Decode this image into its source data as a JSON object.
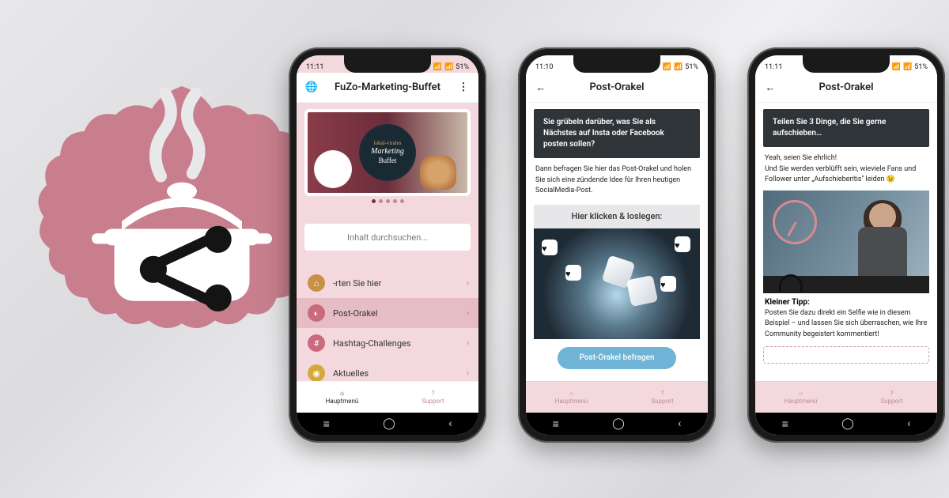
{
  "status": {
    "time1": "11:11",
    "time2": "11:10",
    "time3": "11:11",
    "battery": "51%"
  },
  "badge": {
    "color": "#c87e8d"
  },
  "phone1": {
    "title": "FuZo-Marketing-Buffet",
    "hero": {
      "line1": "lokal-virales",
      "line2": "Marketing",
      "line3": "Buffet"
    },
    "search_placeholder": "Inhalt durchsuchen...",
    "menu": [
      {
        "label": "-rten Sie hier"
      },
      {
        "label": "Post-Orakel"
      },
      {
        "label": "Hashtag-Challenges"
      },
      {
        "label": "Aktuelles"
      }
    ],
    "nav": {
      "home": "Hauptmenü",
      "support": "Support"
    }
  },
  "phone2": {
    "title": "Post-Orakel",
    "headline": "Sie grübeln darüber, was Sie als Nächstes auf Insta oder Facebook posten sollen?",
    "body": "Dann befragen Sie hier das Post-Orakel und holen Sie sich eine zündende Idee für Ihren heutigen SocialMedia-Post.",
    "cta_head": "Hier klicken & loslegen:",
    "button": "Post-Orakel befragen",
    "nav": {
      "home": "Hauptmenü",
      "support": "Support"
    }
  },
  "phone3": {
    "title": "Post-Orakel",
    "headline": "Teilen Sie 3 Dinge, die Sie gerne aufschieben…",
    "body": "Yeah, seien Sie ehrlich!\nUnd Sie werden verblüfft sein, wieviele Fans und Follower unter „Aufschieberitis\" leiden 😉",
    "tip_head": "Kleiner Tipp:",
    "tip_body": "Posten Sie dazu direkt ein Selfie wie in diesem Beispiel – und lassen Sie sich überraschen, wie Ihre Community begeistert kommentiert!",
    "nav": {
      "home": "Hauptmenü",
      "support": "Support"
    }
  }
}
